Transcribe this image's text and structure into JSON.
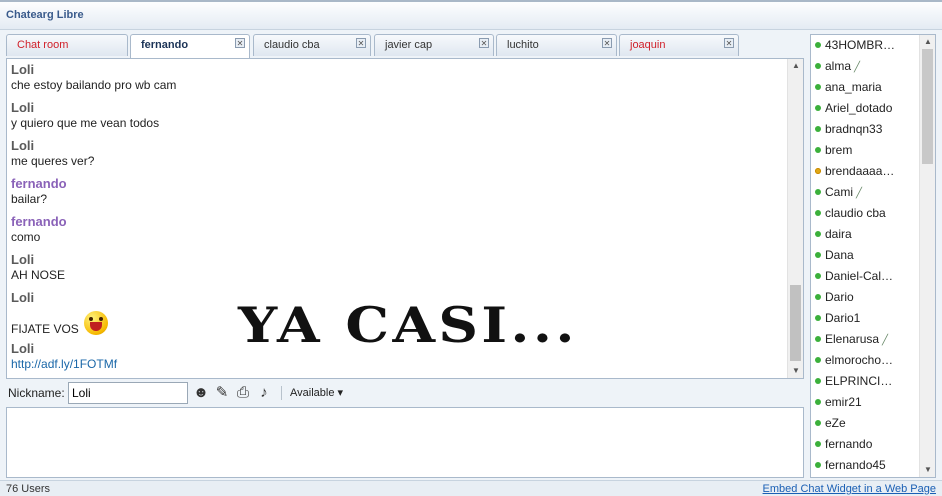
{
  "app": {
    "title": "Chatearg Libre"
  },
  "tabs": [
    {
      "label": "Chat room"
    },
    {
      "label": "fernando"
    },
    {
      "label": "claudio cba"
    },
    {
      "label": "javier cap"
    },
    {
      "label": "luchito"
    },
    {
      "label": "joaquin"
    }
  ],
  "messages": [
    {
      "sender": "Loli",
      "text": "che estoy bailando pro wb cam"
    },
    {
      "sender": "Loli",
      "text": "y quiero que me vean todos"
    },
    {
      "sender": "Loli",
      "text": "me queres ver?"
    },
    {
      "sender": "fernando",
      "text": "bailar?"
    },
    {
      "sender": "fernando",
      "text": "como"
    },
    {
      "sender": "Loli",
      "text": "AH NOSE"
    },
    {
      "sender": "Loli",
      "text": "FIJATE VOS",
      "icon": "laughing-emoji-icon"
    },
    {
      "sender": "Loli",
      "text": "http://adf.ly/1FOTMf"
    }
  ],
  "overlay": {
    "text": "YA CASI..."
  },
  "nickbar": {
    "label": "Nickname:",
    "value": "Loli",
    "status": "Available ▾",
    "tools": [
      "smiley-icon",
      "wrench-icon",
      "print-icon",
      "sound-icon"
    ]
  },
  "users": [
    {
      "name": "43HOMBR…",
      "status": "online"
    },
    {
      "name": "alma",
      "status": "online",
      "pen": true
    },
    {
      "name": "ana_maria",
      "status": "online"
    },
    {
      "name": "Ariel_dotado",
      "status": "online"
    },
    {
      "name": "bradnqn33",
      "status": "online"
    },
    {
      "name": "brem",
      "status": "online"
    },
    {
      "name": "brendaaaa…",
      "status": "away"
    },
    {
      "name": "Cami",
      "status": "online",
      "pen": true
    },
    {
      "name": "claudio cba",
      "status": "online"
    },
    {
      "name": "daira",
      "status": "online"
    },
    {
      "name": "Dana",
      "status": "online"
    },
    {
      "name": "Daniel-Cal…",
      "status": "online"
    },
    {
      "name": "Dario",
      "status": "online"
    },
    {
      "name": "Dario1",
      "status": "online"
    },
    {
      "name": "Elenarusa",
      "status": "online",
      "pen": true
    },
    {
      "name": "elmorocho…",
      "status": "online"
    },
    {
      "name": "ELPRINCI…",
      "status": "online"
    },
    {
      "name": "emir21",
      "status": "online"
    },
    {
      "name": "eZe",
      "status": "online"
    },
    {
      "name": "fernando",
      "status": "online"
    },
    {
      "name": "fernando45",
      "status": "online"
    }
  ],
  "footer": {
    "user_count": "76 Users",
    "embed_link": "Embed Chat Widget in a Web Page"
  },
  "colors": {
    "accent": "#3a5b8c",
    "tab_unread": "#d0202a",
    "fernando_name": "#8a62b8",
    "online_dot": "#3bb03b",
    "away_dot": "#e0a816",
    "link": "#1a5fb4"
  }
}
